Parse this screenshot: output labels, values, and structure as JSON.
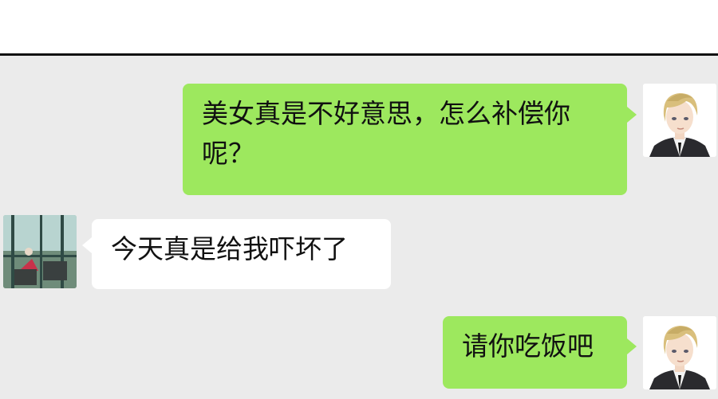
{
  "chat": {
    "messages": [
      {
        "sender": "self",
        "text": "美女真是不好意思，怎么补偿你呢？"
      },
      {
        "sender": "other",
        "text": "今天真是给我吓坏了"
      },
      {
        "sender": "self",
        "text": "请你吃饭吧"
      }
    ]
  },
  "colors": {
    "chat_background": "#ebebeb",
    "self_bubble": "#9de85e",
    "other_bubble": "#ffffff"
  },
  "icons": {
    "self_avatar": "blond-man-avatar-icon",
    "other_avatar": "balcony-photo-avatar-icon"
  }
}
